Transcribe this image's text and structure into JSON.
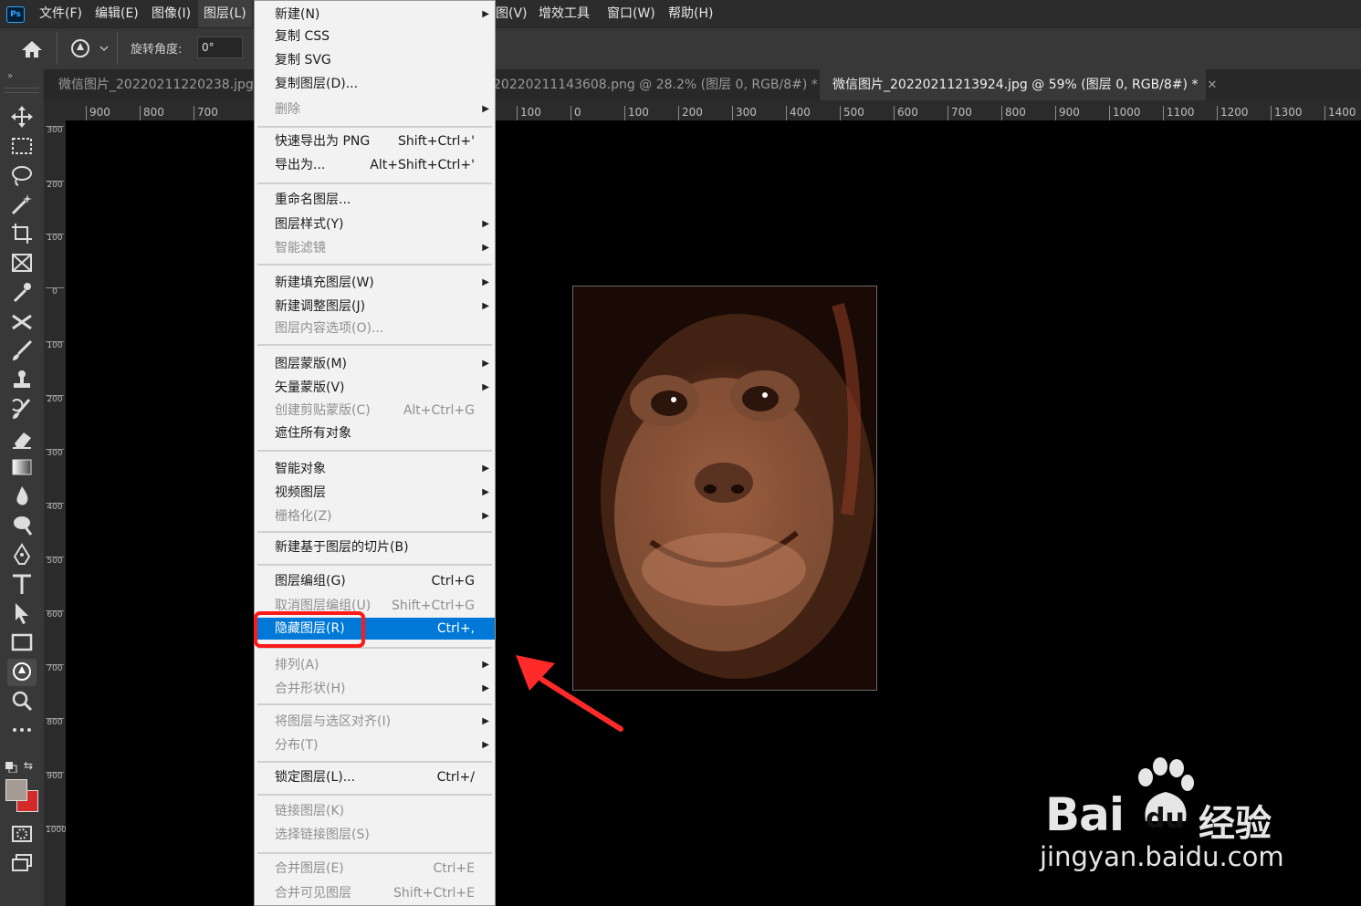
{
  "app": {
    "logo_text": "Ps"
  },
  "menubar": [
    {
      "label": "文件(F)"
    },
    {
      "label": "编辑(E)"
    },
    {
      "label": "图像(I)"
    },
    {
      "label": "图层(L)"
    },
    {
      "label": "图(V)"
    },
    {
      "label": "增效工具"
    },
    {
      "label": "窗口(W)"
    },
    {
      "label": "帮助(H)"
    }
  ],
  "options": {
    "rotate_label": "旋转角度:",
    "rotate_value": "0°"
  },
  "tabs": [
    {
      "label": "微信图片_20220211220238.jpg @"
    },
    {
      "label": "20220211143608.png @ 28.2% (图层 0, RGB/8#) *"
    },
    {
      "label": "微信图片_20220211213924.jpg @ 59% (图层 0, RGB/8#) *"
    }
  ],
  "ruler": {
    "h_ticks": [
      "900",
      "800",
      "700",
      "100",
      "0",
      "100",
      "200",
      "300",
      "400",
      "500",
      "600",
      "700",
      "800",
      "900",
      "1000",
      "1100",
      "1200",
      "1300",
      "1400"
    ],
    "v_ticks": [
      "300",
      "200",
      "100",
      "0",
      "100",
      "200",
      "300",
      "400",
      "500",
      "600",
      "700",
      "800",
      "900",
      "1000"
    ]
  },
  "layer_menu": {
    "items": [
      {
        "label": "新建(N)",
        "shortcut": "",
        "submenu": true,
        "disabled": false
      },
      {
        "label": "复制 CSS",
        "shortcut": "",
        "submenu": false,
        "disabled": false
      },
      {
        "label": "复制 SVG",
        "shortcut": "",
        "submenu": false,
        "disabled": false
      },
      {
        "label": "复制图层(D)...",
        "shortcut": "",
        "submenu": false,
        "disabled": false
      },
      {
        "label": "删除",
        "shortcut": "",
        "submenu": true,
        "disabled": true
      },
      {
        "label": "快速导出为 PNG",
        "shortcut": "Shift+Ctrl+'",
        "submenu": false,
        "disabled": false
      },
      {
        "label": "导出为...",
        "shortcut": "Alt+Shift+Ctrl+'",
        "submenu": false,
        "disabled": false
      },
      {
        "label": "重命名图层...",
        "shortcut": "",
        "submenu": false,
        "disabled": false
      },
      {
        "label": "图层样式(Y)",
        "shortcut": "",
        "submenu": true,
        "disabled": false
      },
      {
        "label": "智能滤镜",
        "shortcut": "",
        "submenu": true,
        "disabled": true
      },
      {
        "label": "新建填充图层(W)",
        "shortcut": "",
        "submenu": true,
        "disabled": false
      },
      {
        "label": "新建调整图层(J)",
        "shortcut": "",
        "submenu": true,
        "disabled": false
      },
      {
        "label": "图层内容选项(O)...",
        "shortcut": "",
        "submenu": false,
        "disabled": true
      },
      {
        "label": "图层蒙版(M)",
        "shortcut": "",
        "submenu": true,
        "disabled": false
      },
      {
        "label": "矢量蒙版(V)",
        "shortcut": "",
        "submenu": true,
        "disabled": false
      },
      {
        "label": "创建剪贴蒙版(C)",
        "shortcut": "Alt+Ctrl+G",
        "submenu": false,
        "disabled": true
      },
      {
        "label": "遮住所有对象",
        "shortcut": "",
        "submenu": false,
        "disabled": false
      },
      {
        "label": "智能对象",
        "shortcut": "",
        "submenu": true,
        "disabled": false
      },
      {
        "label": "视频图层",
        "shortcut": "",
        "submenu": true,
        "disabled": false
      },
      {
        "label": "栅格化(Z)",
        "shortcut": "",
        "submenu": true,
        "disabled": true
      },
      {
        "label": "新建基于图层的切片(B)",
        "shortcut": "",
        "submenu": false,
        "disabled": false
      },
      {
        "label": "图层编组(G)",
        "shortcut": "Ctrl+G",
        "submenu": false,
        "disabled": false
      },
      {
        "label": "取消图层编组(U)",
        "shortcut": "Shift+Ctrl+G",
        "submenu": false,
        "disabled": true
      },
      {
        "label": "隐藏图层(R)",
        "shortcut": "Ctrl+,",
        "submenu": false,
        "disabled": false,
        "highlighted": true
      },
      {
        "label": "排列(A)",
        "shortcut": "",
        "submenu": true,
        "disabled": true
      },
      {
        "label": "合并形状(H)",
        "shortcut": "",
        "submenu": true,
        "disabled": true
      },
      {
        "label": "将图层与选区对齐(I)",
        "shortcut": "",
        "submenu": true,
        "disabled": true
      },
      {
        "label": "分布(T)",
        "shortcut": "",
        "submenu": true,
        "disabled": true
      },
      {
        "label": "锁定图层(L)...",
        "shortcut": "Ctrl+/",
        "submenu": false,
        "disabled": false
      },
      {
        "label": "链接图层(K)",
        "shortcut": "",
        "submenu": false,
        "disabled": true
      },
      {
        "label": "选择链接图层(S)",
        "shortcut": "",
        "submenu": false,
        "disabled": true
      },
      {
        "label": "合并图层(E)",
        "shortcut": "Ctrl+E",
        "submenu": false,
        "disabled": true
      },
      {
        "label": "合并可见图层",
        "shortcut": "Shift+Ctrl+E",
        "submenu": false,
        "disabled": true
      }
    ]
  },
  "watermark": {
    "brand": "Bai",
    "brand2": "du",
    "product": "经验",
    "url": "jingyan.baidu.com"
  },
  "colors": {
    "accent": "#0078d7",
    "annotation": "#ff1a1a",
    "bg_dark": "#2c2c2c"
  }
}
